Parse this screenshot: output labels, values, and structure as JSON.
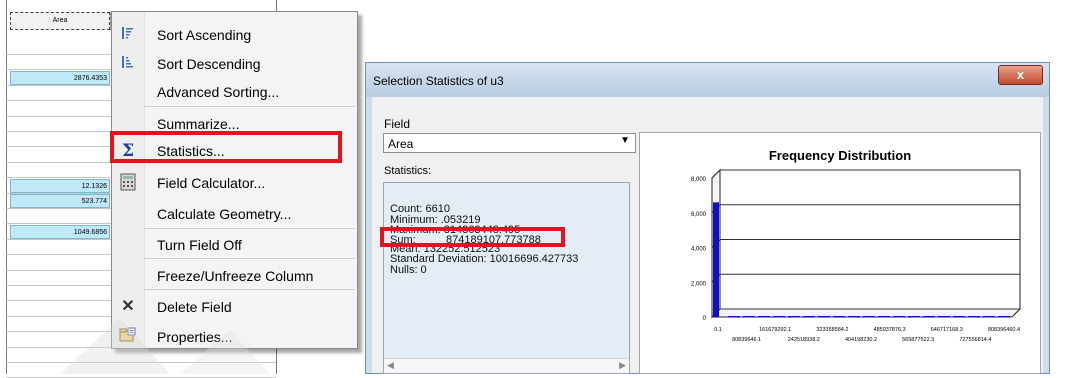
{
  "attribute_table": {
    "column_header": "Area",
    "rows": [
      {
        "value": "",
        "selected": false
      },
      {
        "value": "",
        "selected": false
      },
      {
        "value": "2876.4353",
        "selected": true
      },
      {
        "value": "",
        "selected": false
      },
      {
        "value": "",
        "selected": false
      },
      {
        "value": "",
        "selected": false
      },
      {
        "value": "",
        "selected": false
      },
      {
        "value": "",
        "selected": false
      },
      {
        "value": "",
        "selected": false
      },
      {
        "value": "12.1326",
        "selected": true
      },
      {
        "value": "523.774",
        "selected": true
      },
      {
        "value": "",
        "selected": false
      },
      {
        "value": "1049.6856",
        "selected": true
      },
      {
        "value": "",
        "selected": false
      },
      {
        "value": "",
        "selected": false
      },
      {
        "value": "",
        "selected": false
      },
      {
        "value": "",
        "selected": false
      },
      {
        "value": "",
        "selected": false
      },
      {
        "value": "",
        "selected": false
      },
      {
        "value": "",
        "selected": false
      },
      {
        "value": "",
        "selected": false
      },
      {
        "value": "",
        "selected": false
      }
    ]
  },
  "context_menu": {
    "items": [
      {
        "label": "Sort Ascending",
        "icon": "sort-ascending-icon"
      },
      {
        "label": "Sort Descending",
        "icon": "sort-descending-icon"
      },
      {
        "label": "Advanced Sorting...",
        "icon": ""
      },
      {
        "label": "Summarize...",
        "icon": ""
      },
      {
        "label": "Statistics...",
        "icon": "sigma-icon",
        "highlighted": true
      },
      {
        "label": "Field Calculator...",
        "icon": "calculator-icon"
      },
      {
        "label": "Calculate Geometry...",
        "icon": ""
      },
      {
        "label": "Turn Field Off",
        "icon": ""
      },
      {
        "label": "Freeze/Unfreeze Column",
        "icon": ""
      },
      {
        "label": "Delete Field",
        "icon": "delete-x-icon"
      },
      {
        "label": "Properties...",
        "icon": "properties-icon"
      }
    ]
  },
  "dialog": {
    "title": "Selection Statistics of u3",
    "close_label": "x",
    "field_label": "Field",
    "field_value": "Area",
    "statistics_label": "Statistics:",
    "stats": {
      "count": "Count:   6610",
      "minimum": "Minimum: .053219",
      "maximum": "Maximum: 814363448.495",
      "sum_label": "Sum:",
      "sum_value": "874189107.773788",
      "mean": "Mean:     132252.512523",
      "std": "Standard Deviation: 10016696.427733",
      "nulls": "Nulls:     0"
    }
  },
  "colors": {
    "highlight_red": "#e0141e",
    "bar_blue": "#1010c0",
    "selection_cyan": "#bfe9f9"
  },
  "chart_data": {
    "type": "bar",
    "title": "Frequency Distribution",
    "xlabel": "",
    "ylabel": "",
    "ylim": [
      0,
      8000
    ],
    "y_ticks": [
      "0",
      "2,000",
      "4,000",
      "6,000",
      "8,000"
    ],
    "x_ticks_row1": [
      "0.1",
      "161679292.1",
      "323358584.2",
      "485037876.3",
      "646717168.3",
      "808396460.4"
    ],
    "x_ticks_row2": [
      "80839646.1",
      "242518938.2",
      "404198230.2",
      "565877522.3",
      "727556814.4"
    ],
    "values": [
      6600,
      5,
      3,
      2,
      2,
      1,
      1,
      1,
      1,
      1,
      1,
      1,
      1,
      1,
      1,
      1,
      1,
      1,
      1,
      1
    ],
    "grid": true,
    "legend": "none"
  }
}
